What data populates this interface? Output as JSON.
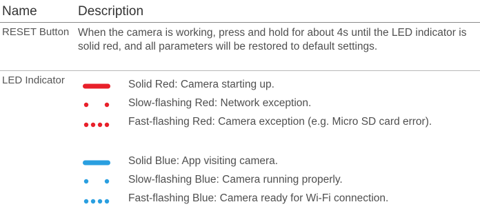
{
  "table": {
    "header": {
      "name": "Name",
      "description": "Description"
    },
    "rows": [
      {
        "name": "RESET Button",
        "description": "When the camera is working, press and hold for about 4s until the LED indicator is solid red, and all parameters will be restored to default settings."
      },
      {
        "name": "LED Indicator",
        "states": [
          {
            "pattern": "solid",
            "color": "#e8202a",
            "text": "Solid Red: Camera starting up."
          },
          {
            "pattern": "slow-flash",
            "color": "#e8202a",
            "text": "Slow-flashing Red: Network exception."
          },
          {
            "pattern": "fast-flash",
            "color": "#e8202a",
            "text": "Fast-flashing Red: Camera exception (e.g. Micro SD card error)."
          },
          {
            "pattern": "solid",
            "color": "#2a9fe0",
            "text": "Solid Blue: App visiting camera."
          },
          {
            "pattern": "slow-flash",
            "color": "#2a9fe0",
            "text": "Slow-flashing Blue: Camera running properly."
          },
          {
            "pattern": "fast-flash",
            "color": "#2a9fe0",
            "text": "Fast-flashing Blue: Camera ready for Wi-Fi connection."
          }
        ]
      }
    ]
  }
}
